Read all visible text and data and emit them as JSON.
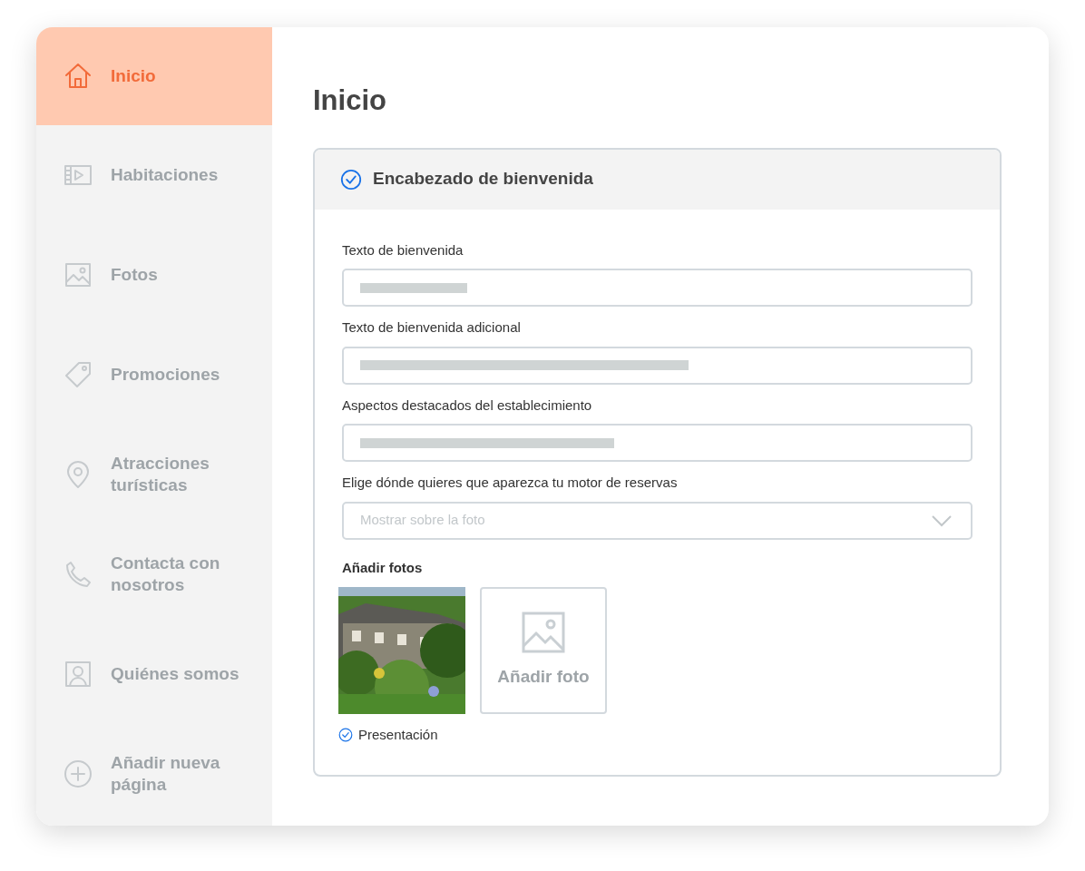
{
  "sidebar": {
    "items": [
      {
        "label": "Inicio",
        "selected": true
      },
      {
        "label": "Habitaciones",
        "selected": false
      },
      {
        "label": "Fotos",
        "selected": false
      },
      {
        "label": "Promociones",
        "selected": false
      },
      {
        "label": "Atracciones turísticas",
        "selected": false
      },
      {
        "label": "Contacta con nosotros",
        "selected": false
      },
      {
        "label": "Quiénes somos",
        "selected": false
      },
      {
        "label": "Añadir nueva página",
        "selected": false
      }
    ]
  },
  "page": {
    "title": "Inicio"
  },
  "section": {
    "title": "Encabezado de bienvenida",
    "complete": true,
    "fields": [
      {
        "kind": "text",
        "label": "Texto de bienvenida"
      },
      {
        "kind": "text",
        "label": "Texto de bienvenida adicional"
      },
      {
        "kind": "text",
        "label": "Aspectos destacados del establecimiento"
      },
      {
        "kind": "select",
        "label": "Elige dónde quieres que aparezca tu motor de reservas",
        "placeholder": "Mostrar sobre la foto"
      }
    ],
    "photos": {
      "label": "Añadir fotos",
      "items": [
        {
          "kind": "picture",
          "caption": "Presentación",
          "checked": true
        }
      ],
      "add_label": "Añadir foto"
    }
  }
}
